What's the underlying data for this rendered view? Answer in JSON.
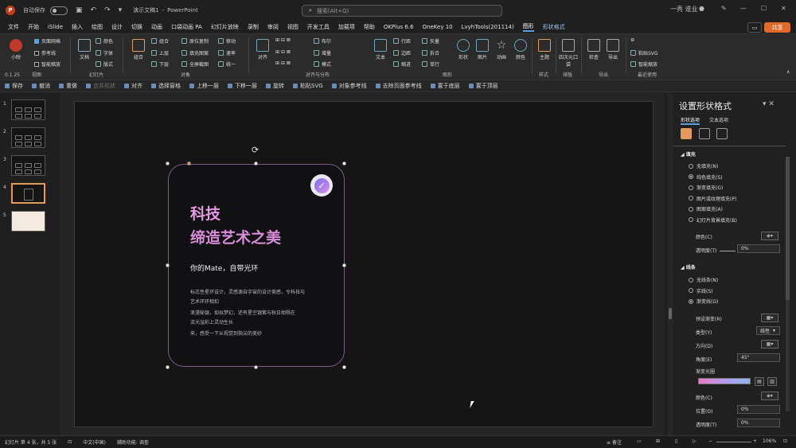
{
  "titlebar": {
    "app_icon": "P",
    "autosave": "自动保存",
    "filename": "演示文稿1",
    "separator": "-",
    "app_name": "PowerPoint",
    "search_placeholder": "搜索(Alt+Q)",
    "user": "一秀 谁业",
    "minimize": "—",
    "restore": "☐",
    "close": "✕"
  },
  "menus": [
    "文件",
    "开始",
    "iSlide",
    "插入",
    "绘图",
    "设计",
    "切换",
    "动画",
    "口袋动画 PA",
    "幻灯片放映",
    "录制",
    "审阅",
    "视图",
    "开发工具",
    "加载项",
    "帮助",
    "OKPlus 6.6",
    "OneKey 10",
    "LvyhTools(201114)",
    "图形",
    "形状格式"
  ],
  "menu_active_index": 19,
  "share_label": "共享",
  "ribbon": {
    "groups": [
      {
        "label": "视图"
      },
      {
        "label": "幻灯片"
      },
      {
        "label": "对象"
      },
      {
        "label": "对齐与分布"
      },
      {
        "label": "图形"
      },
      {
        "label": "样式"
      },
      {
        "label": "排版"
      },
      {
        "label": "导出"
      },
      {
        "label": "最近使用"
      }
    ],
    "version": "0.1.25",
    "items": {
      "xiaoshou": "小映",
      "ymbj": "页面网格",
      "ckx": "参考线",
      "zncz": "智能缩放",
      "wendang": "文档",
      "yanse": "颜色",
      "ziti": "字体",
      "banshi": "版式",
      "jiehe": "组合",
      "shangceng": "上层",
      "xiaceng": "下层",
      "yuanweifuzhi": "原位复制",
      "tianchongtu": "填充图案",
      "quanpinfenge": "全屏截图",
      "bianjie": "移动",
      "sulv": "速率",
      "tongyi": "统一",
      "buleer": "布尔",
      "zengliang": "增量",
      "moshi": "模式",
      "duiqi": "对齐",
      "xinghang": "行距",
      "biankuang": "边距",
      "suojin": "缩进",
      "dange": "单行",
      "jianyingtiao": "矢量",
      "chaifen": "拆合",
      "wenben": "文本",
      "xingzhuang": "形状",
      "tupian": "图片",
      "donghua": "动画",
      "yanse2": "颜色",
      "tujian": "主题",
      "siyuanfen": "四次元口袋",
      "jiancha": "检查",
      "daochu": "导出",
      "niantiesvg": "粘贴SVG",
      "zhinenghuanmo": "智能缩放"
    }
  },
  "qat": [
    "保存",
    "撤消",
    "重做",
    "合并形状",
    "对齐",
    "选择窗格",
    "上移一层",
    "下移一层",
    "旋转",
    "粘贴SVG",
    "对象参考线",
    "去除页面参考线",
    "置于底层",
    "置于顶层"
  ],
  "thumbs": [
    "1",
    "2",
    "3",
    "4",
    "5"
  ],
  "slide": {
    "title_line1": "科技",
    "title_line2": "缔造艺术之美",
    "subtitle": "你的Mate，自带光环",
    "body": [
      "标志性星环设计，灵感源自宇宙的设计美感，令科技与",
      "艺术环环相扣",
      "浪漫秘银，如似梦幻，还有星空银紫与秋日胡杨在",
      "流光溢彩上灵动生长",
      "来，感受一下从视觉到指尖的美妙"
    ],
    "badge_icon": "✓",
    "rotate_icon": "⟳"
  },
  "pane": {
    "title": "设置形状格式",
    "tab_shape": "形状选项",
    "tab_text": "文本选项",
    "fill_section": "填充",
    "fill_options": [
      "无填充(N)",
      "纯色填充(S)",
      "渐变填充(G)",
      "图片或纹理填充(P)",
      "图案填充(A)",
      "幻灯片背景填充(B)"
    ],
    "fill_selected": 1,
    "color_label": "颜色(C)",
    "transparency_label": "透明度(T)",
    "transparency_value": "0%",
    "line_section": "线条",
    "line_options": [
      "无线条(N)",
      "实线(S)",
      "渐变线(G)"
    ],
    "line_selected": 2,
    "preset_label": "预设渐变(R)",
    "type_label": "类型(Y)",
    "type_value": "线性",
    "direction_label": "方向(D)",
    "angle_label": "角度(E)",
    "angle_value": "45°",
    "stops_label": "渐变光圈",
    "color2_label": "颜色(C)",
    "position_label": "位置(O)",
    "position_value": "0%",
    "transparency2_label": "透明度(T)",
    "transparency2_value": "0%"
  },
  "status": {
    "slide_info": "幻灯片 第 4 张，共 5 张",
    "lang": "中文(中国)",
    "accessibility": "辅助功能: 调查",
    "notes": "备注",
    "zoom": "106%"
  },
  "colors": {
    "accent": "#5a9fe0",
    "share": "#e06a2a",
    "card_border": "#7c5a8a",
    "title": "#e39ae3"
  }
}
